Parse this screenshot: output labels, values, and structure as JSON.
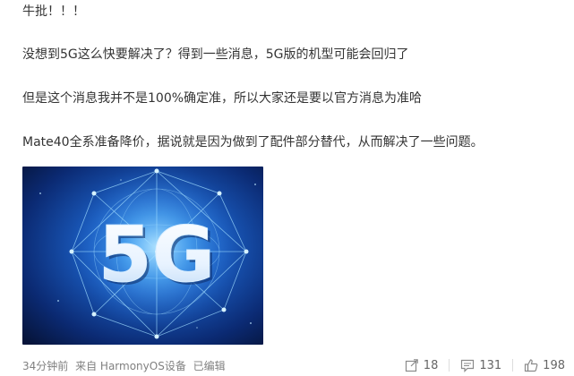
{
  "post": {
    "lines": [
      "牛批！！！",
      "没想到5G这么快要解决了？得到一些消息，5G版的机型可能会回归了",
      "但是这个消息我并不是100%确定准，所以大家还是要以官方消息为准哈",
      "Mate40全系准备降价，据说就是因为做到了配件部分替代，从而解决了一些问题。"
    ],
    "image": {
      "text": "5G",
      "colors": {
        "background_dark": "#06143a",
        "background_light": "#1f6fd0",
        "glow": "#7fd7ff"
      }
    }
  },
  "footer": {
    "time": "34分钟前",
    "source": "来自 HarmonyOS设备",
    "edited": "已编辑",
    "repost_count": "18",
    "comment_count": "131",
    "like_count": "198",
    "icons": {
      "repost": "repost-icon",
      "comment": "comment-icon",
      "like": "like-icon"
    }
  }
}
